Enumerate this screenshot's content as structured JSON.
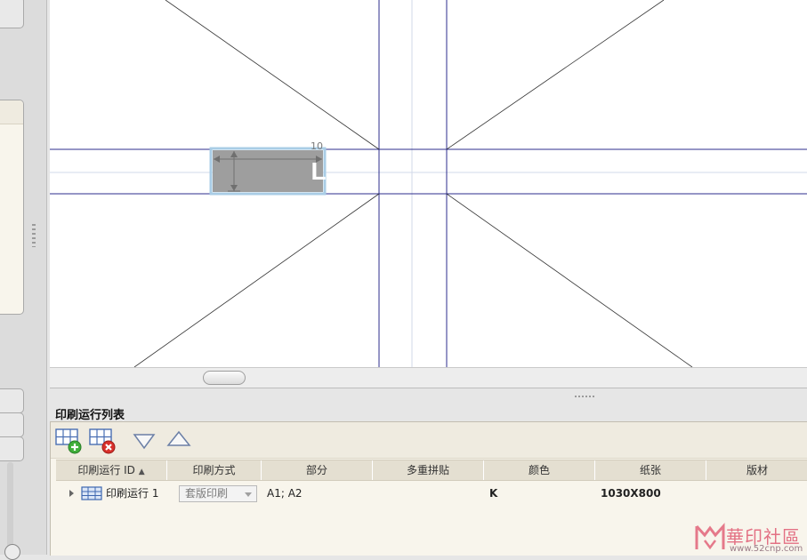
{
  "canvas": {
    "part_label": "L",
    "dimension_label": "10"
  },
  "print_run_panel": {
    "title": "印刷运行列表",
    "toolbar": {
      "add_label": "添加印刷运行",
      "remove_label": "删除印刷运行",
      "move_down_label": "下移",
      "move_up_label": "上移"
    },
    "columns": [
      "印刷运行 ID",
      "印刷方式",
      "部分",
      "多重拼贴",
      "颜色",
      "纸张",
      "版材"
    ],
    "sort_column": "印刷运行 ID",
    "rows": [
      {
        "id": "印刷运行 1",
        "method": "套版印刷",
        "parts": "A1; A2",
        "multi_tile": "",
        "color": "K",
        "paper": "1030X800",
        "plate": ""
      }
    ]
  },
  "watermark": {
    "title": "華印社區",
    "url": "www.52cnp.com"
  }
}
